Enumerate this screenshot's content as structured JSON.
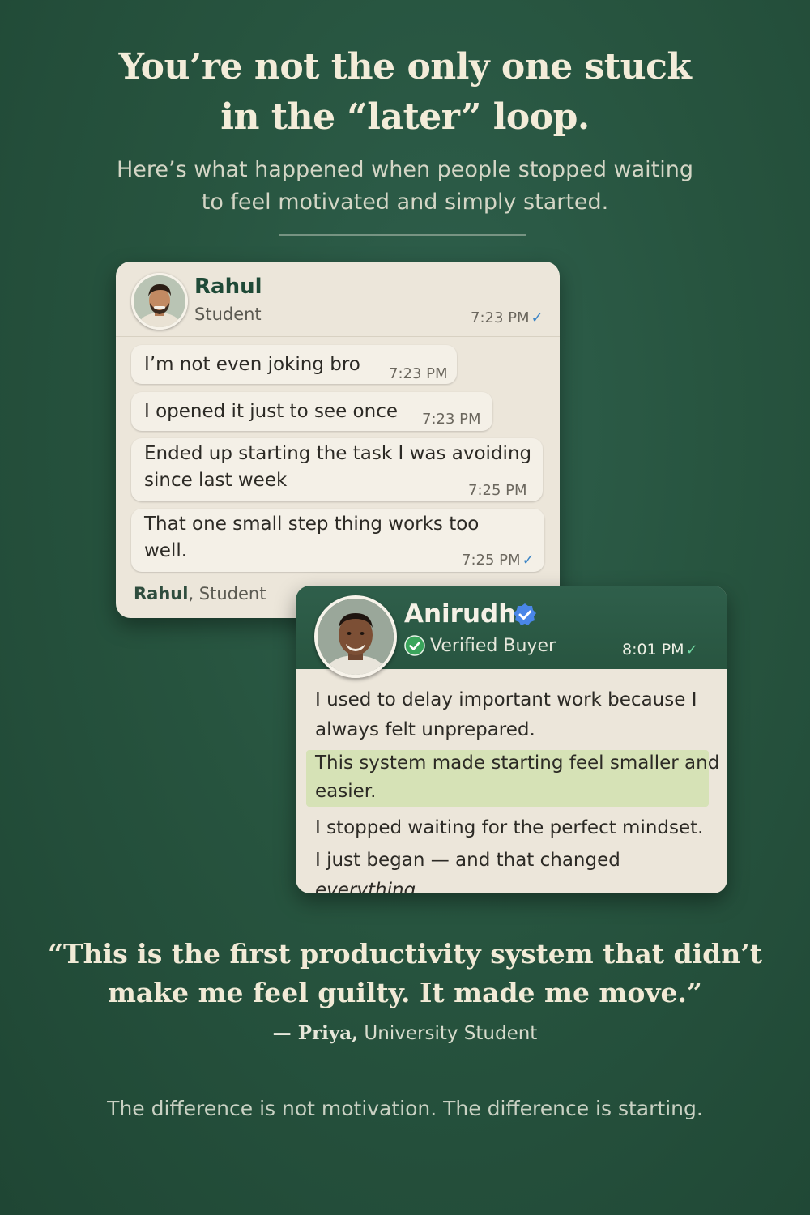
{
  "headline": {
    "line1": "You’re not the only one stuck",
    "line2": "in the “later” loop."
  },
  "subhead": {
    "line1": "Here’s what happened when people stopped waiting",
    "line2": "to feel motivated and simply started."
  },
  "rahul_card": {
    "name": "Rahul",
    "role": "Student",
    "header_time": "7:23 PM",
    "messages": [
      {
        "line1": "I’m not even joking bro",
        "line2": "",
        "time": "7:23 PM"
      },
      {
        "line1": "I opened it just to see once",
        "line2": "",
        "time": "7:23 PM"
      },
      {
        "line1": "Ended up starting the task I was avoiding",
        "line2": "since last week",
        "time": "7:25 PM"
      },
      {
        "line1": "That one small step thing works too",
        "line2": "well.",
        "time": "7:25 PM"
      }
    ],
    "footer_name": "Rahul",
    "footer_role": ", Student"
  },
  "anirudh_card": {
    "name": "Anirudh",
    "badge": "Verified Buyer",
    "time": "8:01 PM",
    "lines": [
      "I used to delay important work because I",
      "always felt unprepared.",
      "This system made starting feel smaller and",
      "easier.",
      "I stopped waiting for the perfect mindset.",
      "I just began — and that changed "
    ],
    "emphasis": "everything."
  },
  "quote": {
    "line1": "“This is the first productivity system that didn’t",
    "line2": "make me feel guilty. It made me move.”"
  },
  "attribution": {
    "dash": "— ",
    "name": "Priya,",
    "role": " University Student"
  },
  "closing": "The difference is not motivation. The difference is starting.",
  "colors": {
    "background": "#27543f",
    "card": "#ece6da",
    "highlight": "#d6e2b6",
    "accent_green": "#1f4a37",
    "read_tick_blue": "#3e86c6",
    "verified_blue": "#4a86e8",
    "verified_green": "#3aa55c"
  },
  "icons": [
    "double-check-icon",
    "verified-badge-icon",
    "green-check-icon"
  ]
}
